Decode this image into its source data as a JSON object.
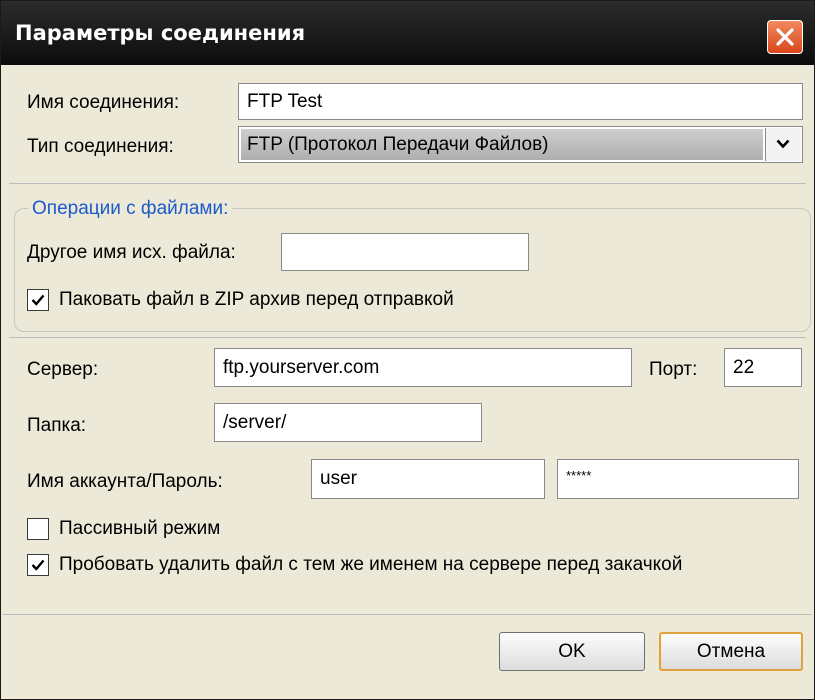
{
  "window": {
    "title": "Параметры соединения"
  },
  "connection": {
    "name_label": "Имя соединения:",
    "name_value": "FTP Test",
    "type_label": "Тип соединения:",
    "type_value": "FTP (Протокол Передачи Файлов)"
  },
  "file_ops": {
    "title": "Операции с файлами:",
    "alt_name_label": "Другое имя исх. файла:",
    "alt_name_value": "",
    "zip_label": "Паковать файл в ZIP архив перед отправкой",
    "zip_checked": true
  },
  "server": {
    "server_label": "Сервер:",
    "server_value": "ftp.yourserver.com",
    "port_label": "Порт:",
    "port_value": "22",
    "folder_label": "Папка:",
    "folder_value": "/server/",
    "account_label": "Имя аккаунта/Пароль:",
    "user_value": "user",
    "password_value": "*****",
    "passive_label": "Пассивный режим",
    "passive_checked": false,
    "delete_label": "Пробовать удалить файл с тем же именем на сервере перед закачкой",
    "delete_checked": true
  },
  "buttons": {
    "ok": "OK",
    "cancel": "Отмена"
  },
  "icons": {
    "close": "close-icon",
    "dropdown": "chevron-down-icon",
    "check": "checkmark-icon"
  },
  "colors": {
    "titlebar": "#141414",
    "close_button": "#e0582a",
    "group_title": "#1d5ac9",
    "dialog_bg": "#ece9d8"
  }
}
